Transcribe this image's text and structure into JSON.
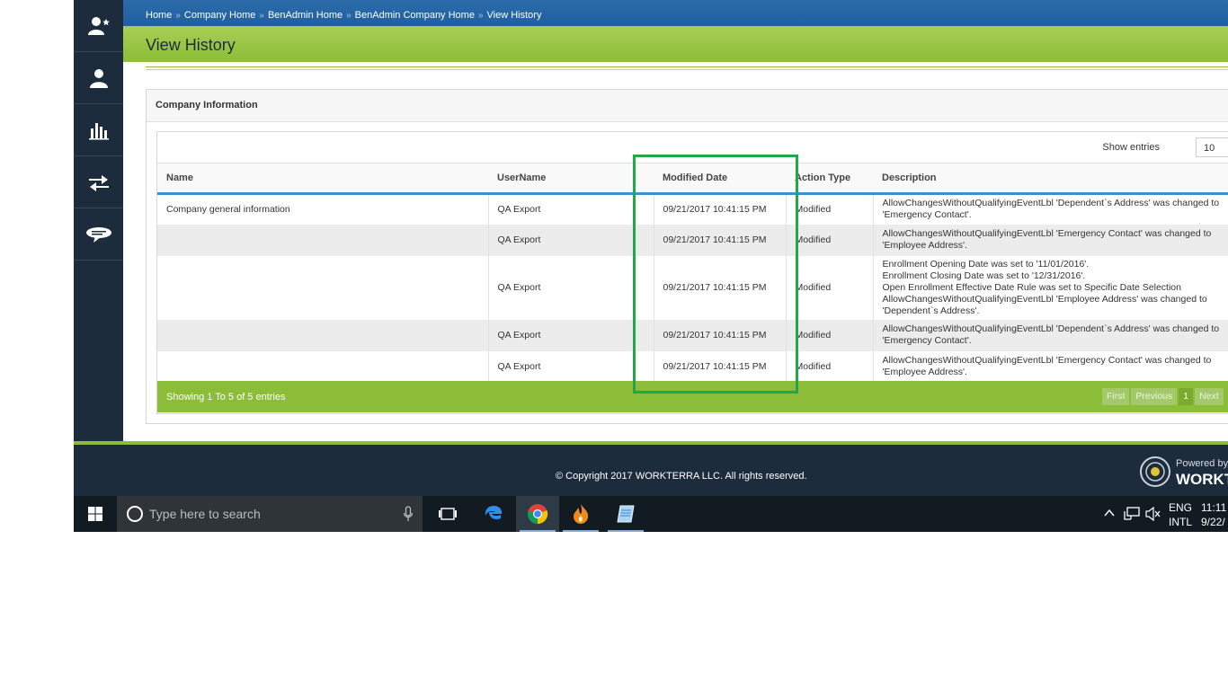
{
  "breadcrumb": [
    "Home",
    "Company Home",
    "BenAdmin Home",
    "BenAdmin Company Home",
    "View History"
  ],
  "breadcrumb_separator": "»",
  "page_title": "View History",
  "panel_title": "Company Information",
  "show_entries": {
    "label": "Show entries",
    "value": "10"
  },
  "table": {
    "columns": [
      "Name",
      "UserName",
      "Modified Date",
      "Action Type",
      "Description"
    ],
    "rows": [
      {
        "name": "Company general information",
        "user": "QA Export",
        "date": "09/21/2017 10:41:15 PM",
        "action": "Modified",
        "desc": "AllowChangesWithoutQualifyingEventLbl 'Dependent`s Address' was changed to\n'Emergency Contact'."
      },
      {
        "name": "",
        "user": "QA Export",
        "date": "09/21/2017 10:41:15 PM",
        "action": "Modified",
        "desc": "AllowChangesWithoutQualifyingEventLbl 'Emergency Contact' was changed to\n'Employee Address'."
      },
      {
        "name": "",
        "user": "QA Export",
        "date": "09/21/2017 10:41:15 PM",
        "action": "Modified",
        "desc": "Enrollment Opening Date was set to '11/01/2016'.\nEnrollment Closing Date was set to '12/31/2016'.\nOpen Enrollment Effective Date Rule was set to Specific Date Selection\nAllowChangesWithoutQualifyingEventLbl 'Employee Address' was changed to\n'Dependent`s Address'."
      },
      {
        "name": "",
        "user": "QA Export",
        "date": "09/21/2017 10:41:15 PM",
        "action": "Modified",
        "desc": "AllowChangesWithoutQualifyingEventLbl 'Dependent`s Address' was changed to\n'Emergency Contact'."
      },
      {
        "name": "",
        "user": "QA Export",
        "date": "09/21/2017 10:41:15 PM",
        "action": "Modified",
        "desc": "AllowChangesWithoutQualifyingEventLbl 'Emergency Contact' was changed to\n'Employee Address'."
      }
    ]
  },
  "summary": "Showing 1 To 5 of 5 entries",
  "pager": {
    "first": "First",
    "previous": "Previous",
    "current": "1",
    "next": "Next"
  },
  "footer": {
    "copyright": "© Copyright 2017 WORKTERRA LLC. All rights reserved.",
    "powered_by": "Powered by",
    "brand": "WORKTERRA"
  },
  "taskbar": {
    "search_placeholder": "Type here to search",
    "lang_top": "ENG",
    "lang_bottom": "INTL",
    "time": "11:11",
    "date": "9/22/"
  },
  "sidebar_icons": [
    "user-star-icon",
    "user-icon",
    "bar-chart-icon",
    "transfer-arrows-icon",
    "chat-bubble-icon"
  ],
  "colors": {
    "nav_dark": "#1d2c3d",
    "brand_green": "#8cbd38",
    "breadcrumb_blue": "#2d6cab",
    "highlight": "#22a84a"
  }
}
